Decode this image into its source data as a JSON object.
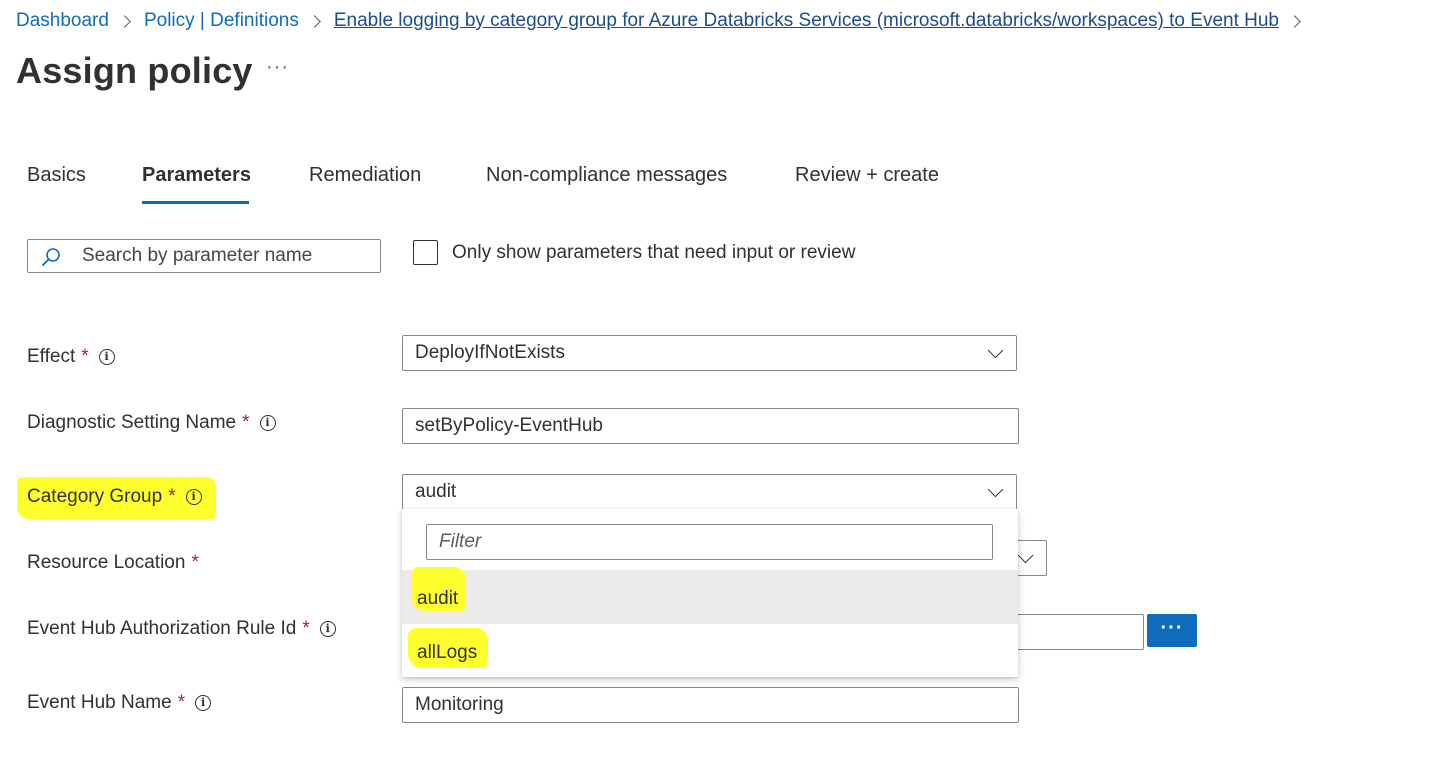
{
  "breadcrumb": {
    "items": [
      {
        "label": "Dashboard"
      },
      {
        "label": "Policy | Definitions"
      },
      {
        "label": "Enable logging by category group for Azure Databricks Services (microsoft.databricks/workspaces) to Event Hub"
      }
    ]
  },
  "page": {
    "title": "Assign policy",
    "more_label": "···"
  },
  "tabs": [
    {
      "label": "Basics"
    },
    {
      "label": "Parameters",
      "active": true
    },
    {
      "label": "Remediation"
    },
    {
      "label": "Non-compliance messages"
    },
    {
      "label": "Review + create"
    }
  ],
  "search": {
    "placeholder": "Search by parameter name",
    "value": ""
  },
  "filter_checkbox": {
    "label": "Only show parameters that need input or review",
    "checked": false
  },
  "fields": {
    "effect": {
      "label": "Effect",
      "required": "*",
      "value": "DeployIfNotExists"
    },
    "diagnostic_setting_name": {
      "label": "Diagnostic Setting Name",
      "required": "*",
      "value": "setByPolicy-EventHub"
    },
    "category_group": {
      "label": "Category Group",
      "required": "*",
      "value": "audit"
    },
    "resource_location": {
      "label": "Resource Location",
      "required": "*"
    },
    "event_hub_auth_rule_id": {
      "label": "Event Hub Authorization Rule Id",
      "required": "*",
      "button_label": "···"
    },
    "event_hub_name": {
      "label": "Event Hub Name",
      "required": "*",
      "value": "Monitoring"
    }
  },
  "dropdown": {
    "filter_placeholder": "Filter",
    "options": [
      {
        "label": "audit",
        "selected": true
      },
      {
        "label": "allLogs",
        "selected": false
      }
    ]
  },
  "colors": {
    "accent": "#0f6cbd",
    "highlight": "#ffff2e",
    "required": "#a4262c",
    "selected_option_bg": "#edebe9"
  },
  "icons": [
    "search-icon",
    "info-icon",
    "chevron-down-icon",
    "chevron-right-icon",
    "more-icon"
  ]
}
